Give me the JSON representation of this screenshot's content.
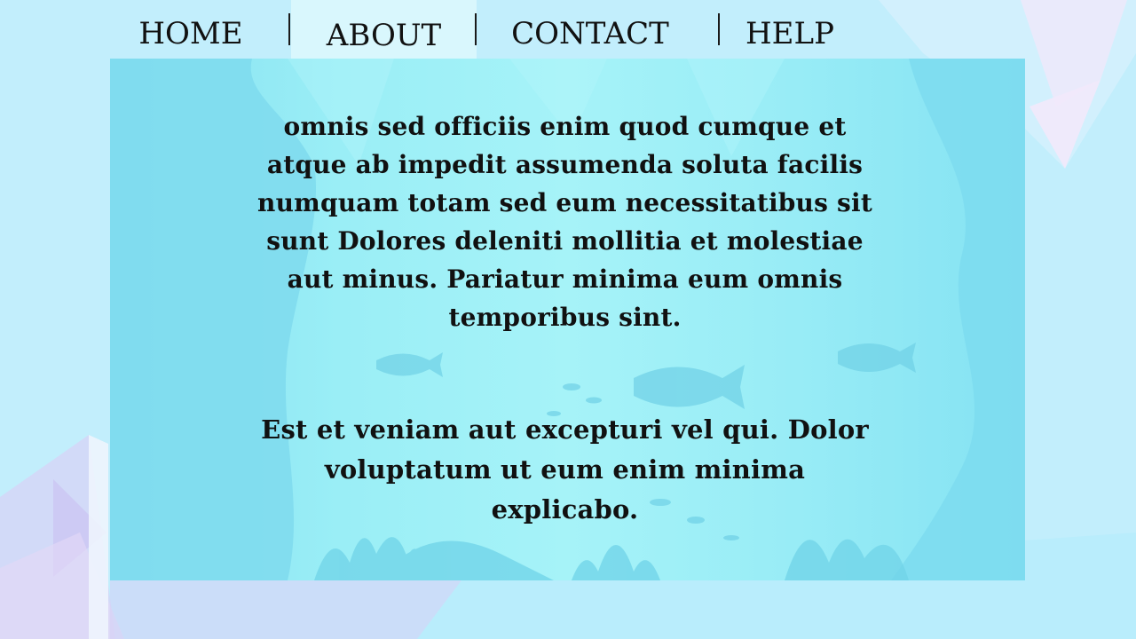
{
  "nav": {
    "tabs": [
      {
        "label": "HOME",
        "active": false
      },
      {
        "label": "ABOUT",
        "active": true
      },
      {
        "label": "CONTACT",
        "active": false
      },
      {
        "label": "HELP",
        "active": false
      }
    ]
  },
  "content": {
    "paragraph_1": "omnis sed officiis enim quod cumque et atque ab impedit assumenda soluta facilis numquam totam sed eum necessitatibus sit sunt Dolores deleniti mollitia et molestiae aut minus. Pariatur minima eum omnis temporibus sint.",
    "paragraph_2": "Est et veniam aut excepturi vel qui. Dolor voluptatum ut eum enim minima explicabo."
  },
  "colors": {
    "page_background": "#c2eefc",
    "panel_background": "#86e4f2",
    "active_tab": "#d9f7fd",
    "text": "#111111"
  }
}
